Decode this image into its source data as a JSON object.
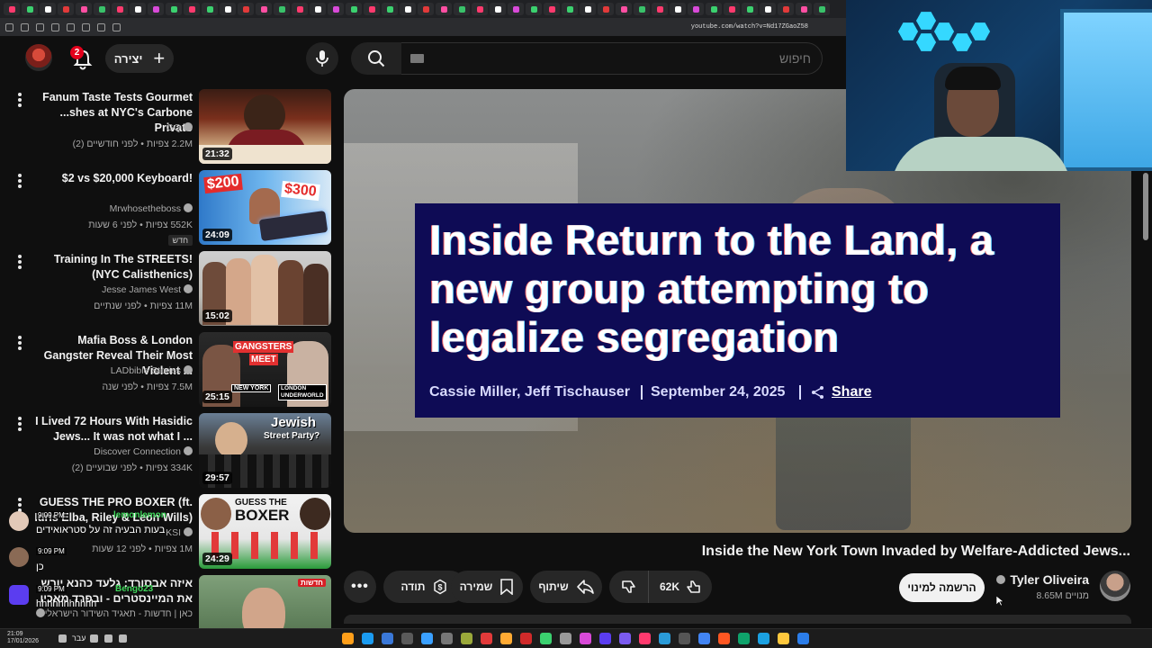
{
  "browser": {
    "url": "youtube.com/watch?v=Nd17ZGaoZ58"
  },
  "header": {
    "notification_count": "2",
    "create_label": "יצירה",
    "search_placeholder": "חיפוש"
  },
  "related": [
    {
      "title": "Fanum Taste Tests Gourmet ...shes at NYC's Carbone Privato",
      "channel": "GQ",
      "meta": "2.2M צפיות • לפני חודשיים (2)",
      "duration": "21:32"
    },
    {
      "title": "$2 vs $20,000 Keyboard!",
      "channel": "Mrwhosetheboss",
      "meta": "552K צפיות • לפני 6 שעות",
      "duration": "24:09",
      "badge": "חדש",
      "thumb_text": [
        "$200",
        "$300"
      ]
    },
    {
      "title": "Training In The STREETS! (NYC Calisthenics)",
      "channel": "Jesse James West",
      "meta": "11M צפיות • לפני שנתיים",
      "duration": "15:02"
    },
    {
      "title": "Mafia Boss & London Gangster Reveal Their Most Violent ...",
      "channel": "LADbible Stories",
      "meta": "7.5M צפיות • לפני שנה",
      "duration": "25:15",
      "thumb_text": [
        "GANGSTERS",
        "MEET",
        "NEW YORK",
        "LONDON UNDERWORLD"
      ]
    },
    {
      "title": "I Lived 72 Hours With Hasidic Jews... It was not what I ...",
      "channel": "Discover Connection",
      "meta": "334K צפיות • לפני שבועיים (2)",
      "duration": "29:57",
      "thumb_text": [
        "Jewish",
        "Street Party?"
      ]
    },
    {
      "title": "GUESS THE PRO BOXER (ft. Idris Elba, Riley & Leon Wills)",
      "channel": "KSI",
      "meta": "1M צפיות • לפני 12 שעות",
      "duration": "24:29",
      "thumb_text": [
        "GUESS THE",
        "BOXER"
      ]
    },
    {
      "title": "איזה אבסורד: גלעד כהנא יורש את המיינסטרים - ובפרד מאכיו",
      "channel": "כאן | חדשות - תאגיד השידור הישראלי",
      "meta": "",
      "duration": "",
      "thumb_text": [
        "חדשות"
      ]
    }
  ],
  "chat": [
    {
      "time": "9:09 PM",
      "user": "lemonlemon",
      "text": "בעות הבעיה זה על סטראואידים"
    },
    {
      "time": "9:09 PM",
      "user": "",
      "text": "כן"
    },
    {
      "time": "9:09 PM",
      "user": "Bengo23",
      "text": "hhhhhhhhhhh"
    }
  ],
  "article": {
    "title": "Inside Return to the Land, a new group attempting to legalize segregation",
    "byline": "Cassie Miller, Jeff Tischauser",
    "date": "September 24, 2025",
    "share": "Share"
  },
  "video": {
    "title": "Inside the New York Town Invaded by Welfare-Addicted Jews...",
    "like_count": "62K",
    "share_label": "שיתוף",
    "save_label": "שמירה",
    "thanks_label": "תודה"
  },
  "channel": {
    "name": "Tyler Oliveira",
    "subscribers": "8.65M מנויים",
    "subscribe_label": "הרשמה למינוי"
  },
  "taskbar": {
    "time": "21:09",
    "date": "17/01/2026",
    "lang": "עבר"
  },
  "colors": {
    "card_bg": "#0e0b55",
    "accent_red": "#e4001c",
    "webcam_glow": "#35d8ff"
  }
}
